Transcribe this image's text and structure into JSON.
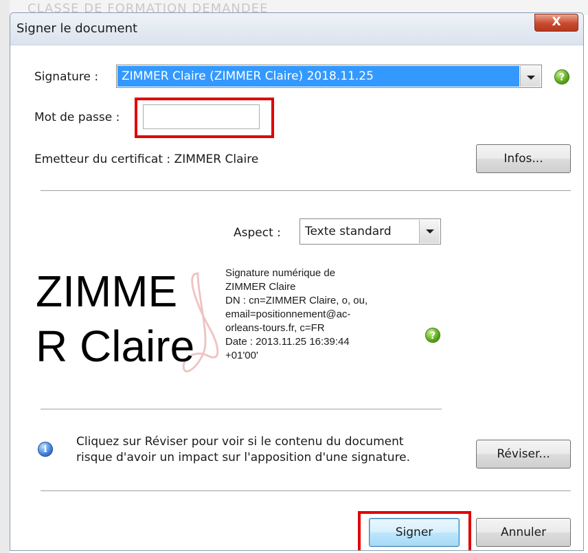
{
  "background": {
    "text": "CLASSE DE FORMATION DEMANDEE"
  },
  "window": {
    "title": "Signer le document",
    "close_label": "X"
  },
  "signature": {
    "label": "Signature :",
    "selected": "ZIMMER Claire (ZIMMER Claire) 2018.11.25",
    "help": "?"
  },
  "password": {
    "label": "Mot de passe :",
    "value": "",
    "placeholder": ""
  },
  "issuer": {
    "text": "Emetteur du certificat : ZIMMER Claire",
    "info_button": "Infos..."
  },
  "aspect": {
    "label": "Aspect :",
    "selected": "Texte standard"
  },
  "preview": {
    "name_line1": "ZIMME",
    "name_line2": "R Claire",
    "details": [
      "Signature numérique de",
      "ZIMMER Claire",
      "DN : cn=ZIMMER Claire, o, ou,",
      "email=positionnement@ac-",
      "orleans-tours.fr, c=FR",
      "Date : 2013.11.25 16:39:44",
      "+01'00'"
    ],
    "help": "?"
  },
  "review": {
    "line1": "Cliquez sur Réviser pour voir si le contenu du document",
    "line2": "risque d'avoir un impact sur l'apposition d'une signature.",
    "button": "Réviser..."
  },
  "actions": {
    "sign": "Signer",
    "cancel": "Annuler"
  },
  "colors": {
    "highlight": "#e10000",
    "selection": "#3399ff"
  },
  "icons": {
    "close": "close-icon",
    "help": "help-icon",
    "info": "info-icon",
    "logo": "adobe-acrobat-logo"
  }
}
